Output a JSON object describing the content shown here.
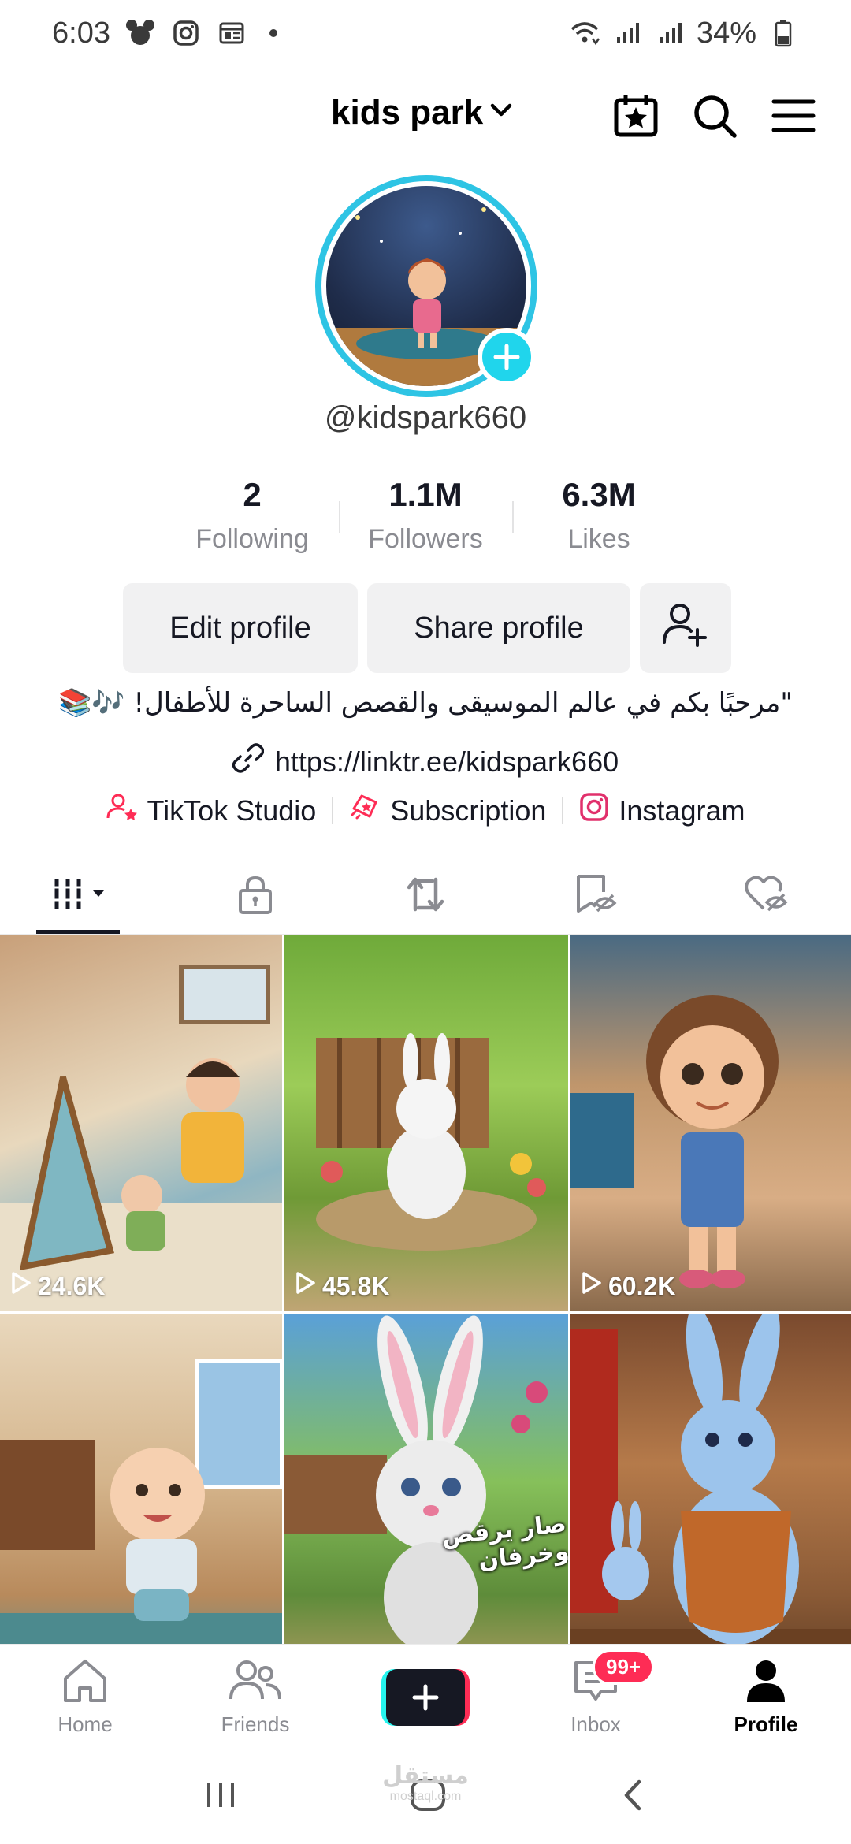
{
  "status_bar": {
    "time": "6:03",
    "battery": "34%",
    "icons": [
      "mickey-icon",
      "instagram-icon",
      "news-icon",
      "notification-dot",
      "wifi-icon",
      "signal-icon",
      "signal-icon",
      "battery-icon"
    ]
  },
  "header": {
    "account_name": "kids park",
    "buttons": [
      "calendar-star-icon",
      "search-icon",
      "menu-icon"
    ]
  },
  "profile": {
    "username": "@kidspark660",
    "stats": [
      {
        "value": "2",
        "label": "Following"
      },
      {
        "value": "1.1M",
        "label": "Followers"
      },
      {
        "value": "6.3M",
        "label": "Likes"
      }
    ],
    "actions": {
      "edit": "Edit profile",
      "share": "Share profile"
    },
    "bio": "\"مرحبًا بكم في عالم الموسيقى والقصص الساحرة للأطفال! 🎶📚",
    "link": "https://linktr.ee/kidspark660",
    "quick_links": [
      {
        "label": "TikTok Studio",
        "icon": "studio-icon"
      },
      {
        "label": "Subscription",
        "icon": "subscription-icon"
      },
      {
        "label": "Instagram",
        "icon": "instagram-icon"
      }
    ]
  },
  "tabs": [
    "videos-grid-icon",
    "private-lock-icon",
    "reposts-icon",
    "favorites-hidden-icon",
    "liked-hidden-icon"
  ],
  "videos": [
    {
      "views": "24.6K"
    },
    {
      "views": "45.8K"
    },
    {
      "views": "60.2K"
    },
    {
      "views": ""
    },
    {
      "views": "",
      "caption": "صار يرقص وخرفان"
    },
    {
      "views": ""
    }
  ],
  "bottom_nav": {
    "home": "Home",
    "friends": "Friends",
    "inbox": "Inbox",
    "inbox_badge": "99+",
    "profile": "Profile"
  },
  "watermark": {
    "main": "مستقل",
    "sub": "mostaql.com"
  },
  "colors": {
    "accent_cyan": "#25f4ee",
    "accent_red": "#fe2c55",
    "avatar_ring": "#2ec4e4",
    "text": "#161823"
  }
}
